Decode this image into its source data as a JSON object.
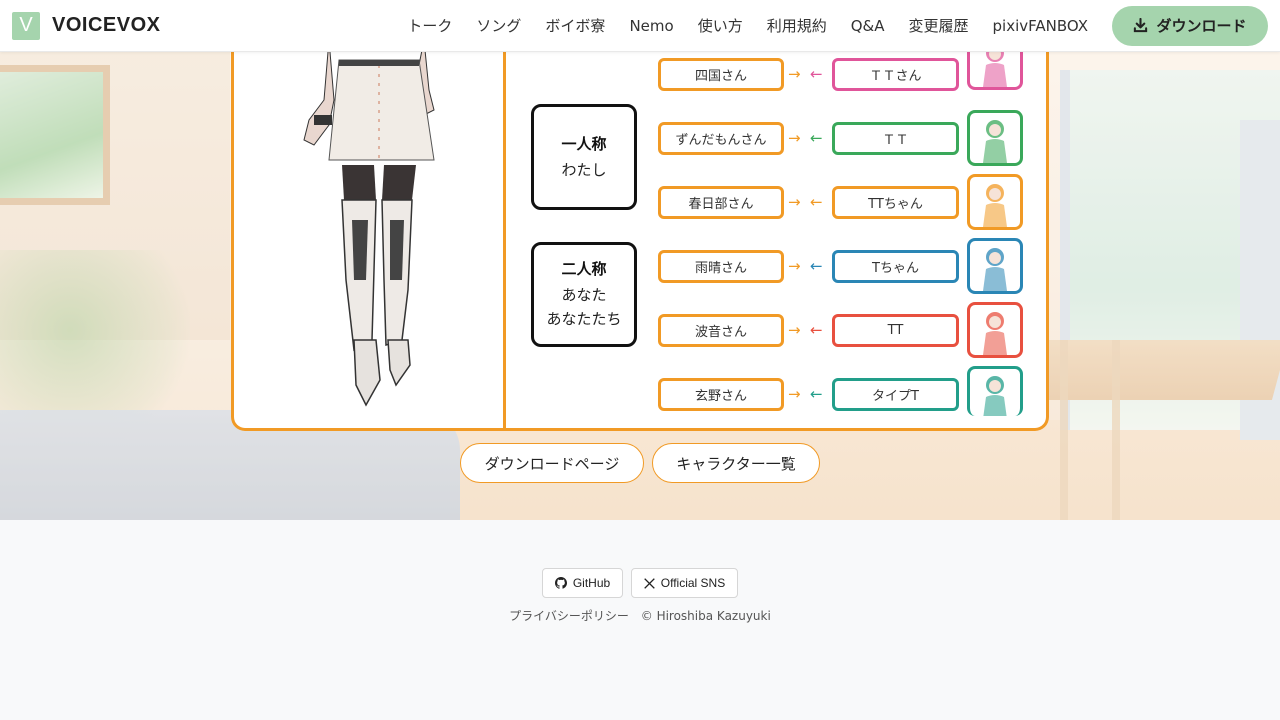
{
  "brand": {
    "logo_letter": "V",
    "name": "VOICEVOX",
    "accent": "#a5d4ad"
  },
  "nav": {
    "items": [
      "トーク",
      "ソング",
      "ボイボ寮",
      "Nemo",
      "使い方",
      "利用規約",
      "Q&A",
      "変更履歴",
      "pixivFANBOX"
    ],
    "download_label": "ダウンロード",
    "download_icon": "download-icon"
  },
  "pronouns": {
    "first": {
      "title": "一人称",
      "words": [
        "わたし"
      ]
    },
    "second": {
      "title": "二人称",
      "words": [
        "あなた",
        "あなたたち"
      ]
    }
  },
  "relations": [
    {
      "they_call": "四国さん",
      "called_as": "ＴＴさん",
      "color": "#e0559a"
    },
    {
      "they_call": "ずんだもんさん",
      "called_as": "ＴＴ",
      "color": "#3aa85a"
    },
    {
      "they_call": "春日部さん",
      "called_as": "TTちゃん",
      "color": "#f19a25"
    },
    {
      "they_call": "雨晴さん",
      "called_as": "Tちゃん",
      "color": "#2a86b5"
    },
    {
      "they_call": "波音さん",
      "called_as": "TT",
      "color": "#e8503f"
    },
    {
      "they_call": "玄野さん",
      "called_as": "タイプT",
      "color": "#229e8a"
    }
  ],
  "colors": {
    "card_border": "#f19a25"
  },
  "buttons": {
    "download_page": "ダウンロードページ",
    "character_list": "キャラクター一覧"
  },
  "footer": {
    "github": "GitHub",
    "sns": "Official SNS",
    "privacy": "プライバシーポリシー",
    "copyright": "© Hiroshiba Kazuyuki"
  }
}
